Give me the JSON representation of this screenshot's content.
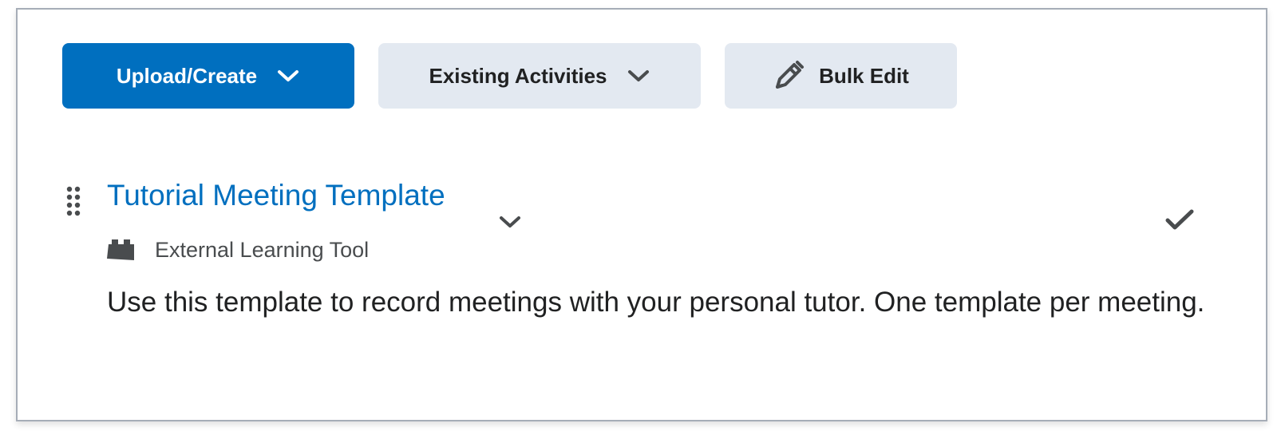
{
  "toolbar": {
    "upload_create_label": "Upload/Create",
    "existing_activities_label": "Existing Activities",
    "bulk_edit_label": "Bulk Edit"
  },
  "item": {
    "title": "Tutorial Meeting Template",
    "type_label": "External Learning Tool",
    "description": "Use this template to record meetings with your personal tutor. One template per meeting."
  },
  "colors": {
    "primary": "#006fbf",
    "secondary_button": "#e3e9f1",
    "text": "#202122",
    "muted_text": "#494c4e"
  },
  "icons": {
    "upload_chevron": "chevron-down-icon",
    "existing_chevron": "chevron-down-icon",
    "bulk_edit": "pencil-edit-icon",
    "drag": "drag-handle-icon",
    "title_chevron": "chevron-down-icon",
    "complete": "checkmark-icon",
    "type": "lego-block-icon"
  }
}
